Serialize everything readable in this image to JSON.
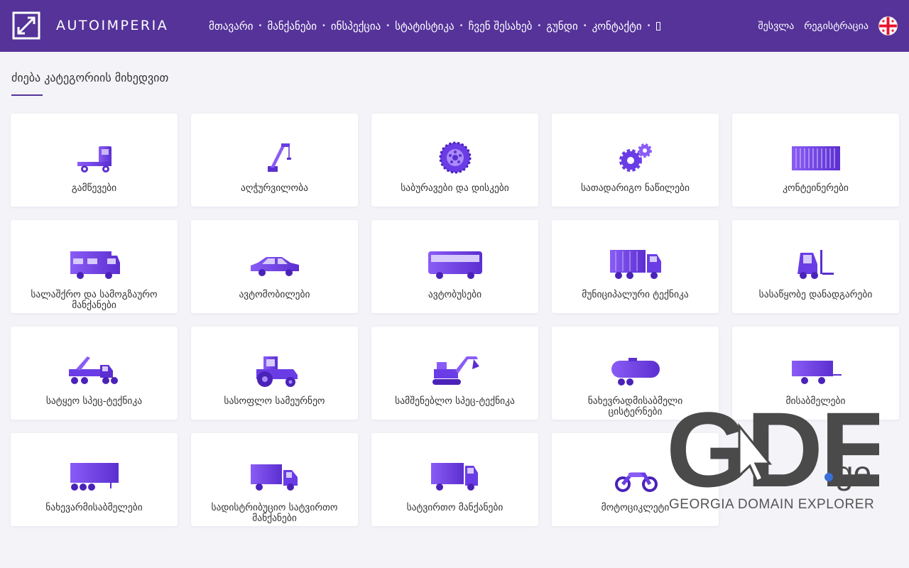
{
  "brand": {
    "name": "AUTOIMPERIA"
  },
  "nav": {
    "items": [
      "მთავარი",
      "მანქანები",
      "ინსპექცია",
      "სტატისტიკა",
      "ჩვენ შესახებ",
      "გუნდი",
      "კონტაქტი",
      ""
    ],
    "separator": "•"
  },
  "auth": {
    "login": "შესვლა",
    "register": "რეგისტრაცია",
    "language_icon": "georgia-flag-icon"
  },
  "section": {
    "title": "ძიება კატეგორიის მიხედვით"
  },
  "categories": [
    {
      "label": "გამწევები",
      "icon": "tractor-unit-icon"
    },
    {
      "label": "აღჭურვილობა",
      "icon": "crane-icon"
    },
    {
      "label": "საბურავები და დისკები",
      "icon": "tire-icon"
    },
    {
      "label": "სათადარიგო ნაწილები",
      "icon": "gears-icon"
    },
    {
      "label": "კონტეინერები",
      "icon": "container-icon"
    },
    {
      "label": "სალაშქრო და სამოგზაურო მანქანები",
      "icon": "camper-icon"
    },
    {
      "label": "ავტომობილები",
      "icon": "car-icon"
    },
    {
      "label": "ავტობუსები",
      "icon": "bus-icon"
    },
    {
      "label": "მუნიციპალური ტექნიკა",
      "icon": "garbage-truck-icon"
    },
    {
      "label": "სასაწყობე დანადგარები",
      "icon": "forklift-icon"
    },
    {
      "label": "სატყეო სპეც-ტექნიკა",
      "icon": "forestry-machine-icon"
    },
    {
      "label": "სასოფლო სამეურნეო",
      "icon": "farm-tractor-icon"
    },
    {
      "label": "სამშენებლო სპეც-ტექნიკა",
      "icon": "excavator-icon"
    },
    {
      "label": "ნახევრადმისაბმელი ცისტერნები",
      "icon": "tank-trailer-icon"
    },
    {
      "label": "მისაბმელები",
      "icon": "trailer-icon"
    },
    {
      "label": "ნახევარმისაბმელები",
      "icon": "semi-trailer-icon"
    },
    {
      "label": "სადისტრიბუციო სატვირთო მანქანები",
      "icon": "delivery-truck-icon"
    },
    {
      "label": "სატვირთო მანქანები",
      "icon": "truck-icon"
    },
    {
      "label": "მოტოციკლეტი",
      "icon": "motorcycle-icon"
    }
  ],
  "watermark": {
    "logo": "GDE.ge",
    "tagline": "GEORGIA DOMAIN EXPLORER"
  },
  "colors": {
    "header": "#553399",
    "accent_light": "#8a5cf6",
    "accent_dark": "#5b2fd0",
    "page_bg": "#f4f4f8"
  }
}
